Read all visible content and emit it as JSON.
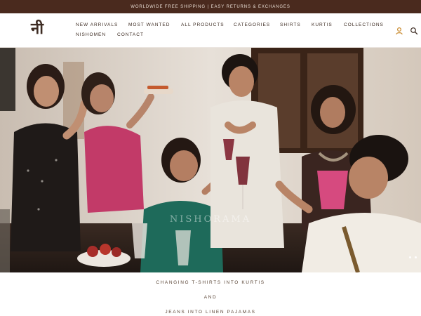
{
  "announcement": {
    "text": "WORLDWIDE FREE SHIPPING | EASY RETURNS & EXCHANGES"
  },
  "header": {
    "logo": "नी",
    "nav": [
      "NEW ARRIVALS",
      "MOST WANTED",
      "ALL PRODUCTS",
      "CATEGORIES",
      "SHIRTS",
      "KURTIS",
      "COLLECTIONS",
      "NISHOMEN",
      "CONTACT"
    ],
    "icons": [
      "account-icon",
      "search-icon"
    ]
  },
  "hero": {
    "watermark": "NISHORAMA",
    "slide_dots": 2
  },
  "tagline": {
    "line1": "CHANGING T-SHIRTS INTO KURTIS",
    "line2": "AND",
    "line3": "JEANS INTO LINEN PAJAMAS"
  },
  "colors": {
    "announcement_bg": "#4a2a1e",
    "text": "#3b2a21",
    "icon_accent": "#c98a2e"
  }
}
